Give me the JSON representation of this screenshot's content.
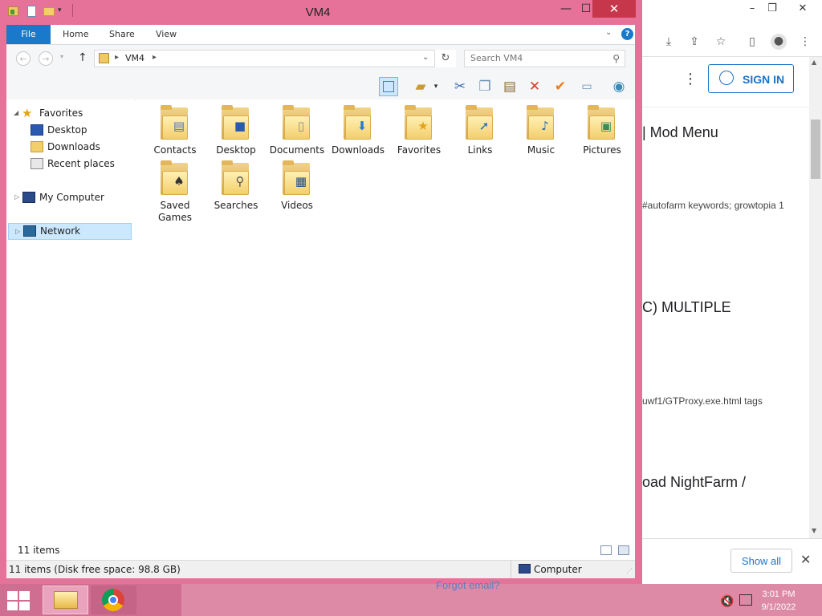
{
  "explorer": {
    "title": "VM4",
    "ribbon_tabs": [
      "File",
      "Home",
      "Share",
      "View"
    ],
    "address_segments": [
      "VM4"
    ],
    "search_placeholder": "Search VM4",
    "nav": {
      "favorites": "Favorites",
      "desktop": "Desktop",
      "downloads": "Downloads",
      "recent_places": "Recent places",
      "my_computer": "My Computer",
      "network": "Network"
    },
    "folders": [
      {
        "label": "Contacts",
        "icon": "contacts-icon"
      },
      {
        "label": "Desktop",
        "icon": "desktop-icon"
      },
      {
        "label": "Documents",
        "icon": "documents-icon"
      },
      {
        "label": "Downloads",
        "icon": "downloads-icon"
      },
      {
        "label": "Favorites",
        "icon": "star-icon"
      },
      {
        "label": "Links",
        "icon": "link-arrow-icon"
      },
      {
        "label": "Music",
        "icon": "music-note-icon"
      },
      {
        "label": "Pictures",
        "icon": "picture-icon"
      },
      {
        "label": "Saved Games",
        "icon": "chess-piece-icon"
      },
      {
        "label": "Searches",
        "icon": "magnifier-icon"
      },
      {
        "label": "Videos",
        "icon": "film-icon"
      }
    ],
    "status_count": "11 items",
    "status_detail": "11 items (Disk free space: 98.8 GB)",
    "status_location": "Computer"
  },
  "browser": {
    "sign_in": "SIGN IN",
    "snippets": [
      {
        "text": "| Mod Menu",
        "kind": "heading"
      },
      {
        "text": "#autofarm keywords; growtopia 1",
        "kind": "small"
      },
      {
        "text": "C) MULTIPLE",
        "kind": "heading"
      },
      {
        "text": "uwf1/GTProxy.exe.html tags",
        "kind": "small"
      },
      {
        "text": "oad NightFarm /",
        "kind": "heading"
      }
    ],
    "show_all": "Show all",
    "forgot": "Forgot email?"
  },
  "taskbar": {
    "time": "3:01 PM",
    "date": "9/1/2022"
  },
  "colors": {
    "window_frame": "#e6729a",
    "taskbar": "#d06e92",
    "ribbon_file": "#1979ca",
    "close_button": "#c7374b",
    "selection": "#cce8ff"
  }
}
